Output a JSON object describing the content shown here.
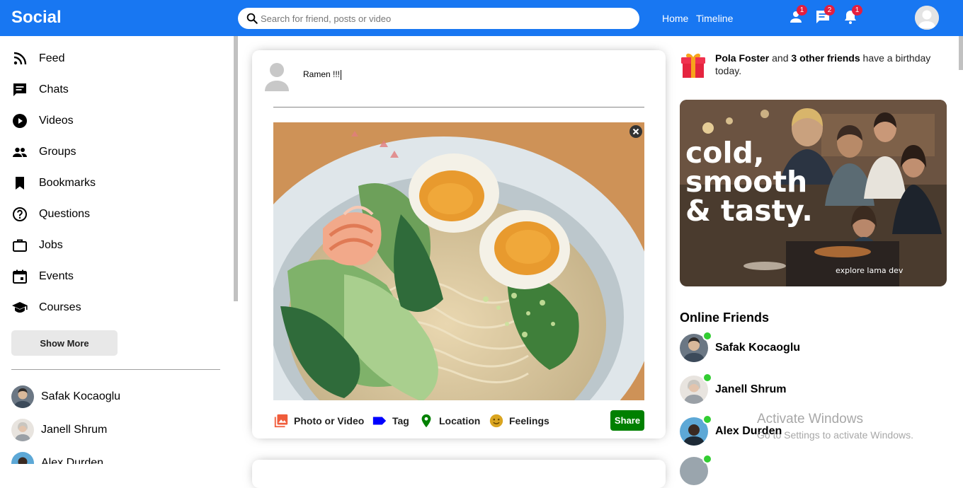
{
  "topbar": {
    "logo": "Social",
    "search_placeholder": "Search for friend, posts or video",
    "links": [
      "Home",
      "Timeline"
    ],
    "badges": {
      "friends": "1",
      "messages": "2",
      "notifications": "1"
    }
  },
  "sidebar": {
    "items": [
      {
        "label": "Feed",
        "icon": "rss-feed-icon"
      },
      {
        "label": "Chats",
        "icon": "chat-icon"
      },
      {
        "label": "Videos",
        "icon": "play-circle-icon"
      },
      {
        "label": "Groups",
        "icon": "group-icon"
      },
      {
        "label": "Bookmarks",
        "icon": "bookmark-icon"
      },
      {
        "label": "Questions",
        "icon": "help-outline-icon"
      },
      {
        "label": "Jobs",
        "icon": "work-outline-icon"
      },
      {
        "label": "Events",
        "icon": "event-icon"
      },
      {
        "label": "Courses",
        "icon": "school-icon"
      }
    ],
    "show_more": "Show More",
    "friends": [
      "Safak Kocaoglu",
      "Janell Shrum",
      "Alex Durden"
    ]
  },
  "share": {
    "text": "Ramen !!!",
    "options": [
      "Photo or Video",
      "Tag",
      "Location",
      "Feelings"
    ],
    "share_label": "Share"
  },
  "rightbar": {
    "birthday": {
      "name": "Pola Foster",
      "connector": " and ",
      "others": "3 other friends",
      "suffix": " have a birthday today."
    },
    "ad": {
      "line1": "cold,",
      "line2": "smooth",
      "line3": "& tasty.",
      "footer": "explore lama dev"
    },
    "online_title": "Online Friends",
    "online_friends": [
      "Safak Kocaoglu",
      "Janell Shrum",
      "Alex Durden"
    ]
  },
  "overlay": {
    "activate_title": "Activate Windows",
    "activate_sub": "Go to Settings to activate Windows."
  },
  "colors": {
    "brand": "#1877f2",
    "share_button": "#008000",
    "online_dot": "#32cd32",
    "badge": "#e41e3f"
  }
}
